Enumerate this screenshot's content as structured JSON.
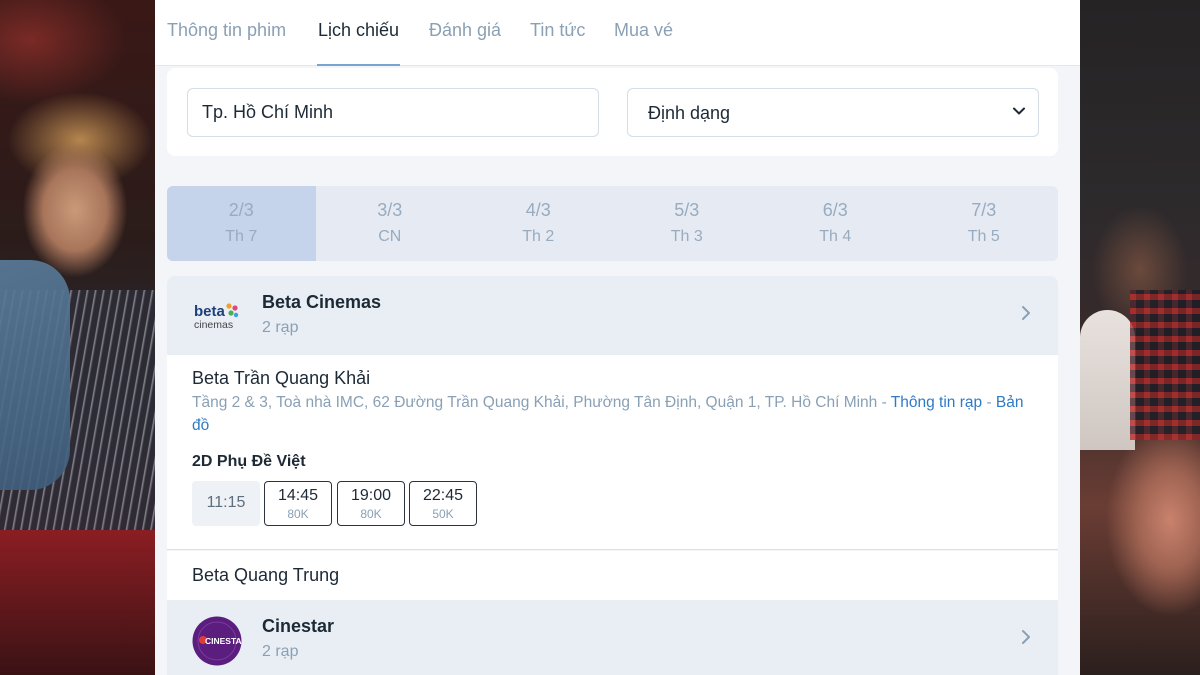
{
  "tabs": [
    {
      "label": "Thông tin phim"
    },
    {
      "label": "Lịch chiếu"
    },
    {
      "label": "Đánh giá"
    },
    {
      "label": "Tin tức"
    },
    {
      "label": "Mua vé"
    }
  ],
  "filters": {
    "city_value": "Tp. Hồ Chí Minh",
    "format_label": "Định dạng"
  },
  "dates": [
    {
      "date": "2/3",
      "weekday": "Th 7",
      "selected": true
    },
    {
      "date": "3/3",
      "weekday": "CN"
    },
    {
      "date": "4/3",
      "weekday": "Th 2"
    },
    {
      "date": "5/3",
      "weekday": "Th 3"
    },
    {
      "date": "6/3",
      "weekday": "Th 4"
    },
    {
      "date": "7/3",
      "weekday": "Th 5"
    }
  ],
  "chains": [
    {
      "name": "Beta Cinemas",
      "count": "2 rạp",
      "logo": "beta-cinemas-logo",
      "logo_text": [
        "beta",
        "cinemas"
      ]
    },
    {
      "name": "Cinestar",
      "count": "2 rạp",
      "logo": "cinestar-logo",
      "logo_text": "CINESTAR"
    }
  ],
  "cinema": {
    "name": "Beta Trần Quang Khải",
    "address": "Tầng 2 & 3, Toà nhà IMC, 62 Đường Trần Quang Khải, Phường Tân Định, Quận 1, TP. Hồ Chí Minh",
    "sep": " - ",
    "info_link": "Thông tin rạp",
    "map_link": "Bản đồ",
    "format": "2D Phụ Đề Việt",
    "showtimes": [
      {
        "time": "11:15",
        "price": "",
        "status": "past"
      },
      {
        "time": "14:45",
        "price": "80K",
        "status": "available"
      },
      {
        "time": "19:00",
        "price": "80K",
        "status": "available"
      },
      {
        "time": "22:45",
        "price": "50K",
        "status": "available"
      }
    ]
  },
  "cinema2": {
    "name": "Beta Quang Trung"
  },
  "colors": {
    "accent": "#2f7ac7",
    "selected_date": "#c5d3eb",
    "muted_text": "#8aa0b5"
  }
}
